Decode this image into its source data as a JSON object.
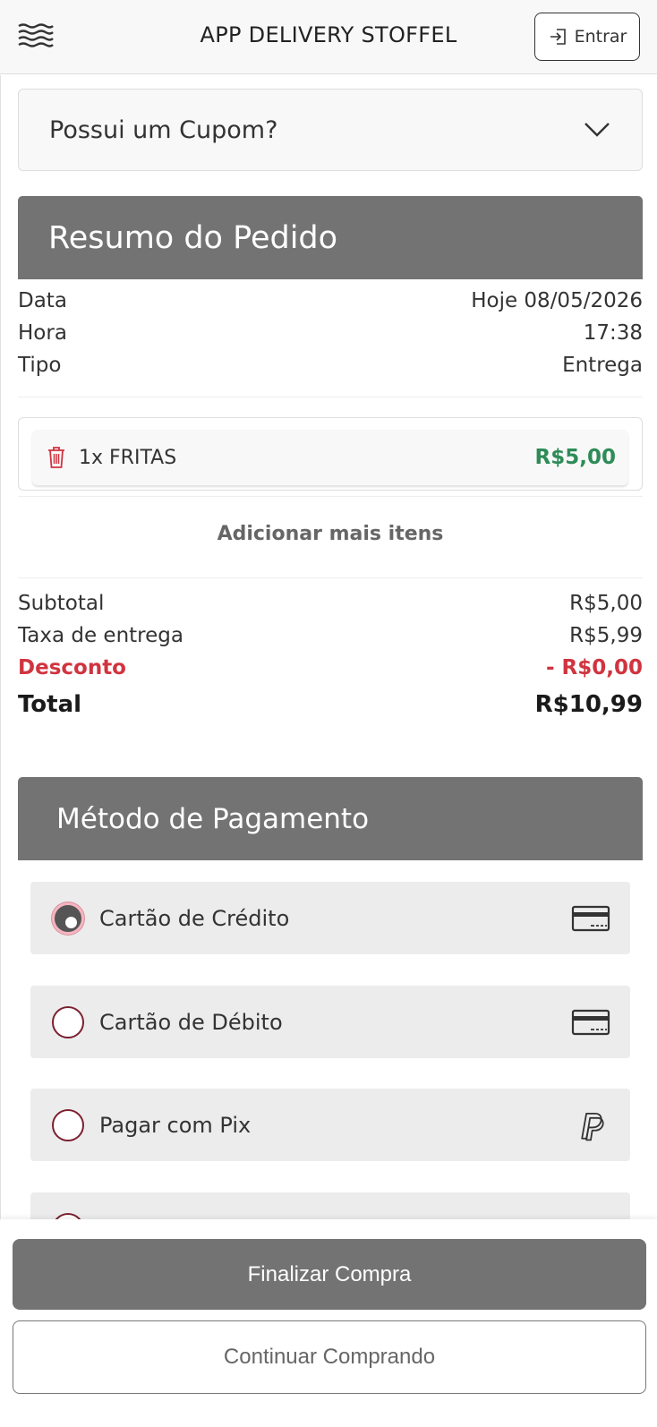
{
  "header": {
    "title": "APP DELIVERY STOFFEL",
    "login_label": "Entrar"
  },
  "coupon": {
    "label": "Possui um Cupom?"
  },
  "summary": {
    "title": "Resumo do Pedido",
    "rows": [
      {
        "label": "Data",
        "value": "Hoje 08/05/2026"
      },
      {
        "label": "Hora",
        "value": "17:38"
      },
      {
        "label": "Tipo",
        "value": "Entrega"
      }
    ],
    "items": [
      {
        "name": "1x FRITAS",
        "price": "R$5,00"
      }
    ],
    "add_more_label": "Adicionar mais itens",
    "subtotal": {
      "label": "Subtotal",
      "value": "R$5,00"
    },
    "delivery_fee": {
      "label": "Taxa de entrega",
      "value": "R$5,99"
    },
    "discount": {
      "label": "Desconto",
      "value": "- R$0,00"
    },
    "total": {
      "label": "Total",
      "value": "R$10,99"
    }
  },
  "payment": {
    "title": "Método de Pagamento",
    "options": [
      {
        "label": "Cartão de Crédito",
        "icon": "credit-card-icon",
        "selected": true
      },
      {
        "label": "Cartão de Débito",
        "icon": "credit-card-icon",
        "selected": false
      },
      {
        "label": "Pagar com Pix",
        "icon": "paypal-icon",
        "selected": false
      }
    ]
  },
  "footer": {
    "finish_label": "Finalizar Compra",
    "continue_label": "Continuar Comprando"
  },
  "colors": {
    "section_header": "#737373",
    "price_green": "#2e8b57",
    "discount_red": "#d0343f",
    "radio_border": "#7b2030"
  }
}
